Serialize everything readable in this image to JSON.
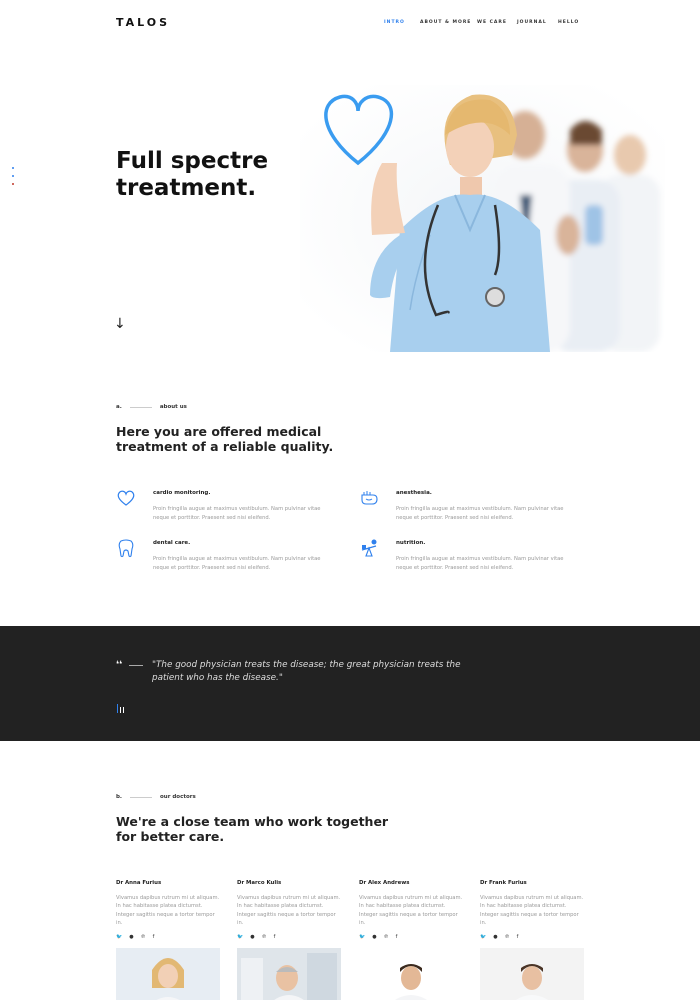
{
  "brand": {
    "logo": "TALOS"
  },
  "nav": {
    "items": [
      {
        "label": "INTRO",
        "active": true
      },
      {
        "label": "ABOUT & MORE",
        "active": false
      },
      {
        "label": "WE CARE",
        "active": false
      },
      {
        "label": "JOURNAL",
        "active": false
      },
      {
        "label": "HELLO",
        "active": false
      }
    ]
  },
  "hero": {
    "title_line1": "Full spectre",
    "title_line2": "treatment.",
    "scroll_icon": "arrow-down-icon",
    "image": "doctors-team-with-nurse-drawing-heart"
  },
  "about": {
    "index": "a.",
    "tag": "about us",
    "heading_line1": "Here you are offered medical",
    "heading_line2": "treatment of a reliable quality.",
    "features": [
      {
        "icon": "heart-icon",
        "title": "cardio monitoring.",
        "desc": "Proin fringilla augue at maximus vestibulum. Nam pulvinar vitae neque et porttitor. Praesent sed nisi eleifend."
      },
      {
        "icon": "anesthesia-icon",
        "title": "anesthesia.",
        "desc": "Proin fringilla augue at maximus vestibulum. Nam pulvinar vitae neque et porttitor. Praesent sed nisi eleifend."
      },
      {
        "icon": "tooth-icon",
        "title": "dental care.",
        "desc": "Proin fringilla augue at maximus vestibulum. Nam pulvinar vitae neque et porttitor. Praesent sed nisi eleifend."
      },
      {
        "icon": "nutrition-icon",
        "title": "nutrition.",
        "desc": "Proin fringilla augue at maximus vestibulum. Nam pulvinar vitae neque et porttitor. Praesent sed nisi eleifend."
      }
    ]
  },
  "quote": {
    "mark": "❛❛",
    "text_line1": "\"The good physician treats the disease; the great physician treats the",
    "text_line2": "patient who has the disease.\""
  },
  "doctors": {
    "index": "b.",
    "tag": "our doctors",
    "heading_line1": "We're a close team who work together",
    "heading_line2": "for better care.",
    "items": [
      {
        "name": "Dr Anna Furius",
        "desc": "Vivamus dapibus rutrum mi ut aliquam. In hac habitasse platea dictumst. Integer sagittis neque a tortor tempor in."
      },
      {
        "name": "Dr Marco Kulis",
        "desc": "Vivamus dapibus rutrum mi ut aliquam. In hac habitasse platea dictumst. Integer sagittis neque a tortor tempor in."
      },
      {
        "name": "Dr Alex Andrews",
        "desc": "Vivamus dapibus rutrum mi ut aliquam. In hac habitasse platea dictumst. Integer sagittis neque a tortor tempor in."
      },
      {
        "name": "Dr Frank Furius",
        "desc": "Vivamus dapibus rutrum mi ut aliquam. In hac habitasse platea dictumst. Integer sagittis neque a tortor tempor in."
      }
    ],
    "social": [
      "twitter-icon",
      "github-icon",
      "pinterest-icon",
      "facebook-icon"
    ]
  },
  "colors": {
    "accent": "#2f80ed",
    "dark_band": "#222222"
  }
}
